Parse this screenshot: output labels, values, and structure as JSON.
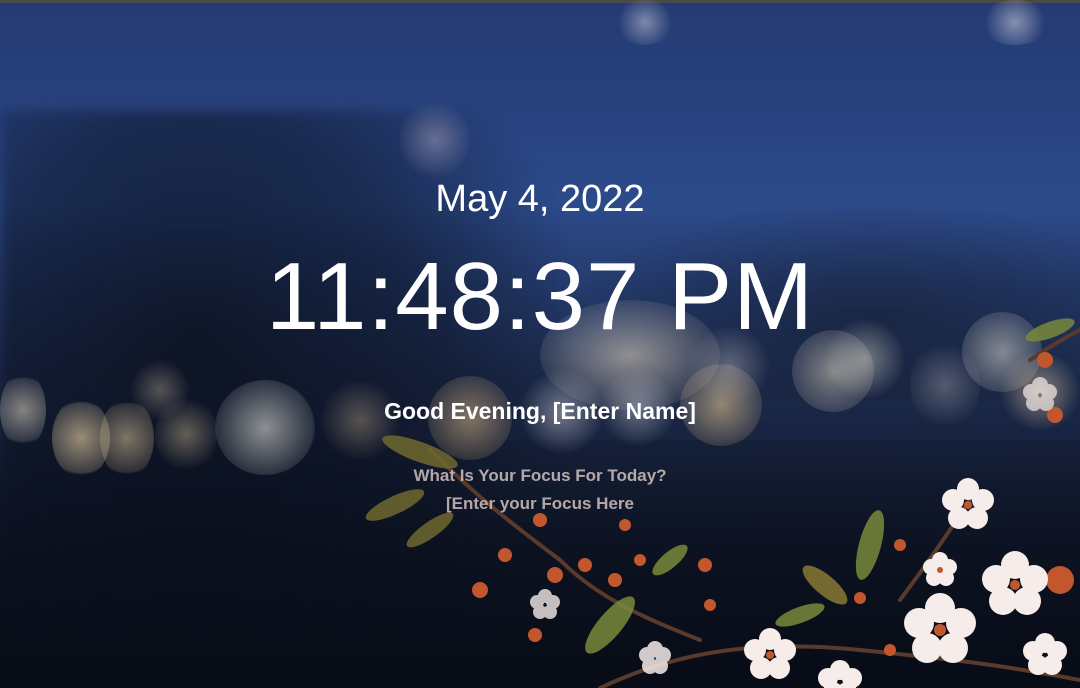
{
  "clock": {
    "date": "May 4, 2022",
    "time": "11:48:37 PM"
  },
  "greeting": {
    "text": "Good Evening,",
    "name": "[Enter Name]"
  },
  "focus": {
    "question": "What Is Your Focus For Today?",
    "value": "[Enter your Focus Here"
  },
  "background": {
    "description_icon": "blossom-bokeh-background",
    "colors": {
      "sky": "#2c4a8a",
      "dark": "#0a101c",
      "bokeh": "#f2d9a6",
      "blossom": "#f7ecea",
      "leaf": "#6b6a2f",
      "text": "#ffffff"
    }
  }
}
